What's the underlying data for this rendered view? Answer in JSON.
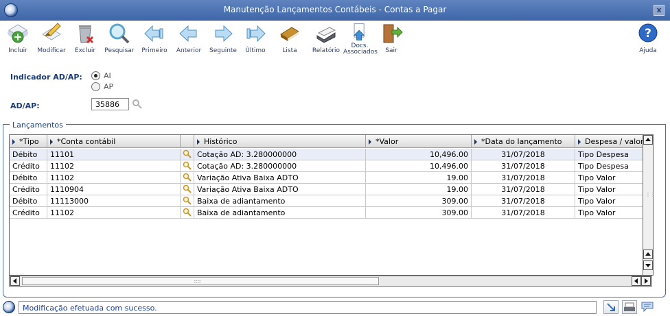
{
  "window": {
    "title": "Manutenção Lançamentos Contábeis - Contas a Pagar",
    "close_label": "x"
  },
  "toolbar": {
    "buttons": [
      {
        "id": "incluir",
        "label": "Incluir",
        "icon": "add-icon"
      },
      {
        "id": "modificar",
        "label": "Modificar",
        "icon": "edit-icon"
      },
      {
        "id": "excluir",
        "label": "Excluir",
        "icon": "delete-icon"
      },
      {
        "id": "pesquisar",
        "label": "Pesquisar",
        "icon": "search-icon"
      },
      {
        "id": "primeiro",
        "label": "Primeiro",
        "icon": "first-icon"
      },
      {
        "id": "anterior",
        "label": "Anterior",
        "icon": "previous-icon"
      },
      {
        "id": "seguinte",
        "label": "Seguinte",
        "icon": "next-icon"
      },
      {
        "id": "ultimo",
        "label": "Último",
        "icon": "last-icon"
      },
      {
        "id": "lista",
        "label": "Lista",
        "icon": "list-icon"
      },
      {
        "id": "relatorio",
        "label": "Relatório",
        "icon": "printer-icon"
      },
      {
        "id": "docs",
        "label": "Docs. Associados",
        "label_line1": "Docs.",
        "label_line2": "Associados",
        "icon": "documents-icon"
      },
      {
        "id": "sair",
        "label": "Sair",
        "icon": "exit-icon"
      }
    ],
    "help_label": "Ajuda"
  },
  "form": {
    "indicator_label": "Indicador AD/AP:",
    "options": [
      {
        "label": "AI",
        "checked": true
      },
      {
        "label": "AP",
        "checked": false
      }
    ],
    "adap_label": "AD/AP:",
    "adap_value": "35886"
  },
  "group": {
    "title": "Lançamentos"
  },
  "grid": {
    "columns": [
      "*Tipo",
      "*Conta contábil",
      "Histórico",
      "*Valor",
      "*Data do lançamento",
      "Despesa / valor"
    ],
    "rows": [
      {
        "tipo": "Débito",
        "conta": "11101",
        "historico": "Cotação AD: 3.280000000",
        "valor": "10,496.00",
        "data": "31/07/2018",
        "despesa": "Tipo Despesa"
      },
      {
        "tipo": "Crédito",
        "conta": "11102",
        "historico": "Cotação AD: 3.280000000",
        "valor": "10,496.00",
        "data": "31/07/2018",
        "despesa": "Tipo Despesa"
      },
      {
        "tipo": "Débito",
        "conta": "11102",
        "historico": "Variação Ativa Baixa ADTO",
        "valor": "19.00",
        "data": "31/07/2018",
        "despesa": "Tipo Valor"
      },
      {
        "tipo": "Crédito",
        "conta": "1110904",
        "historico": "Variação Ativa Baixa ADTO",
        "valor": "19.00",
        "data": "31/07/2018",
        "despesa": "Tipo Valor"
      },
      {
        "tipo": "Débito",
        "conta": "11113000",
        "historico": "Baixa de adiantamento",
        "valor": "309.00",
        "data": "31/07/2018",
        "despesa": "Tipo Valor"
      },
      {
        "tipo": "Crédito",
        "conta": "11102",
        "historico": "Baixa de adiantamento",
        "valor": "309.00",
        "data": "31/07/2018",
        "despesa": "Tipo Valor"
      }
    ]
  },
  "status": {
    "message": "Modificação efetuada com sucesso."
  },
  "colors": {
    "title_bar": "#4a70b0",
    "accent": "#1c3c7a",
    "status_text": "#1b3fa6"
  }
}
